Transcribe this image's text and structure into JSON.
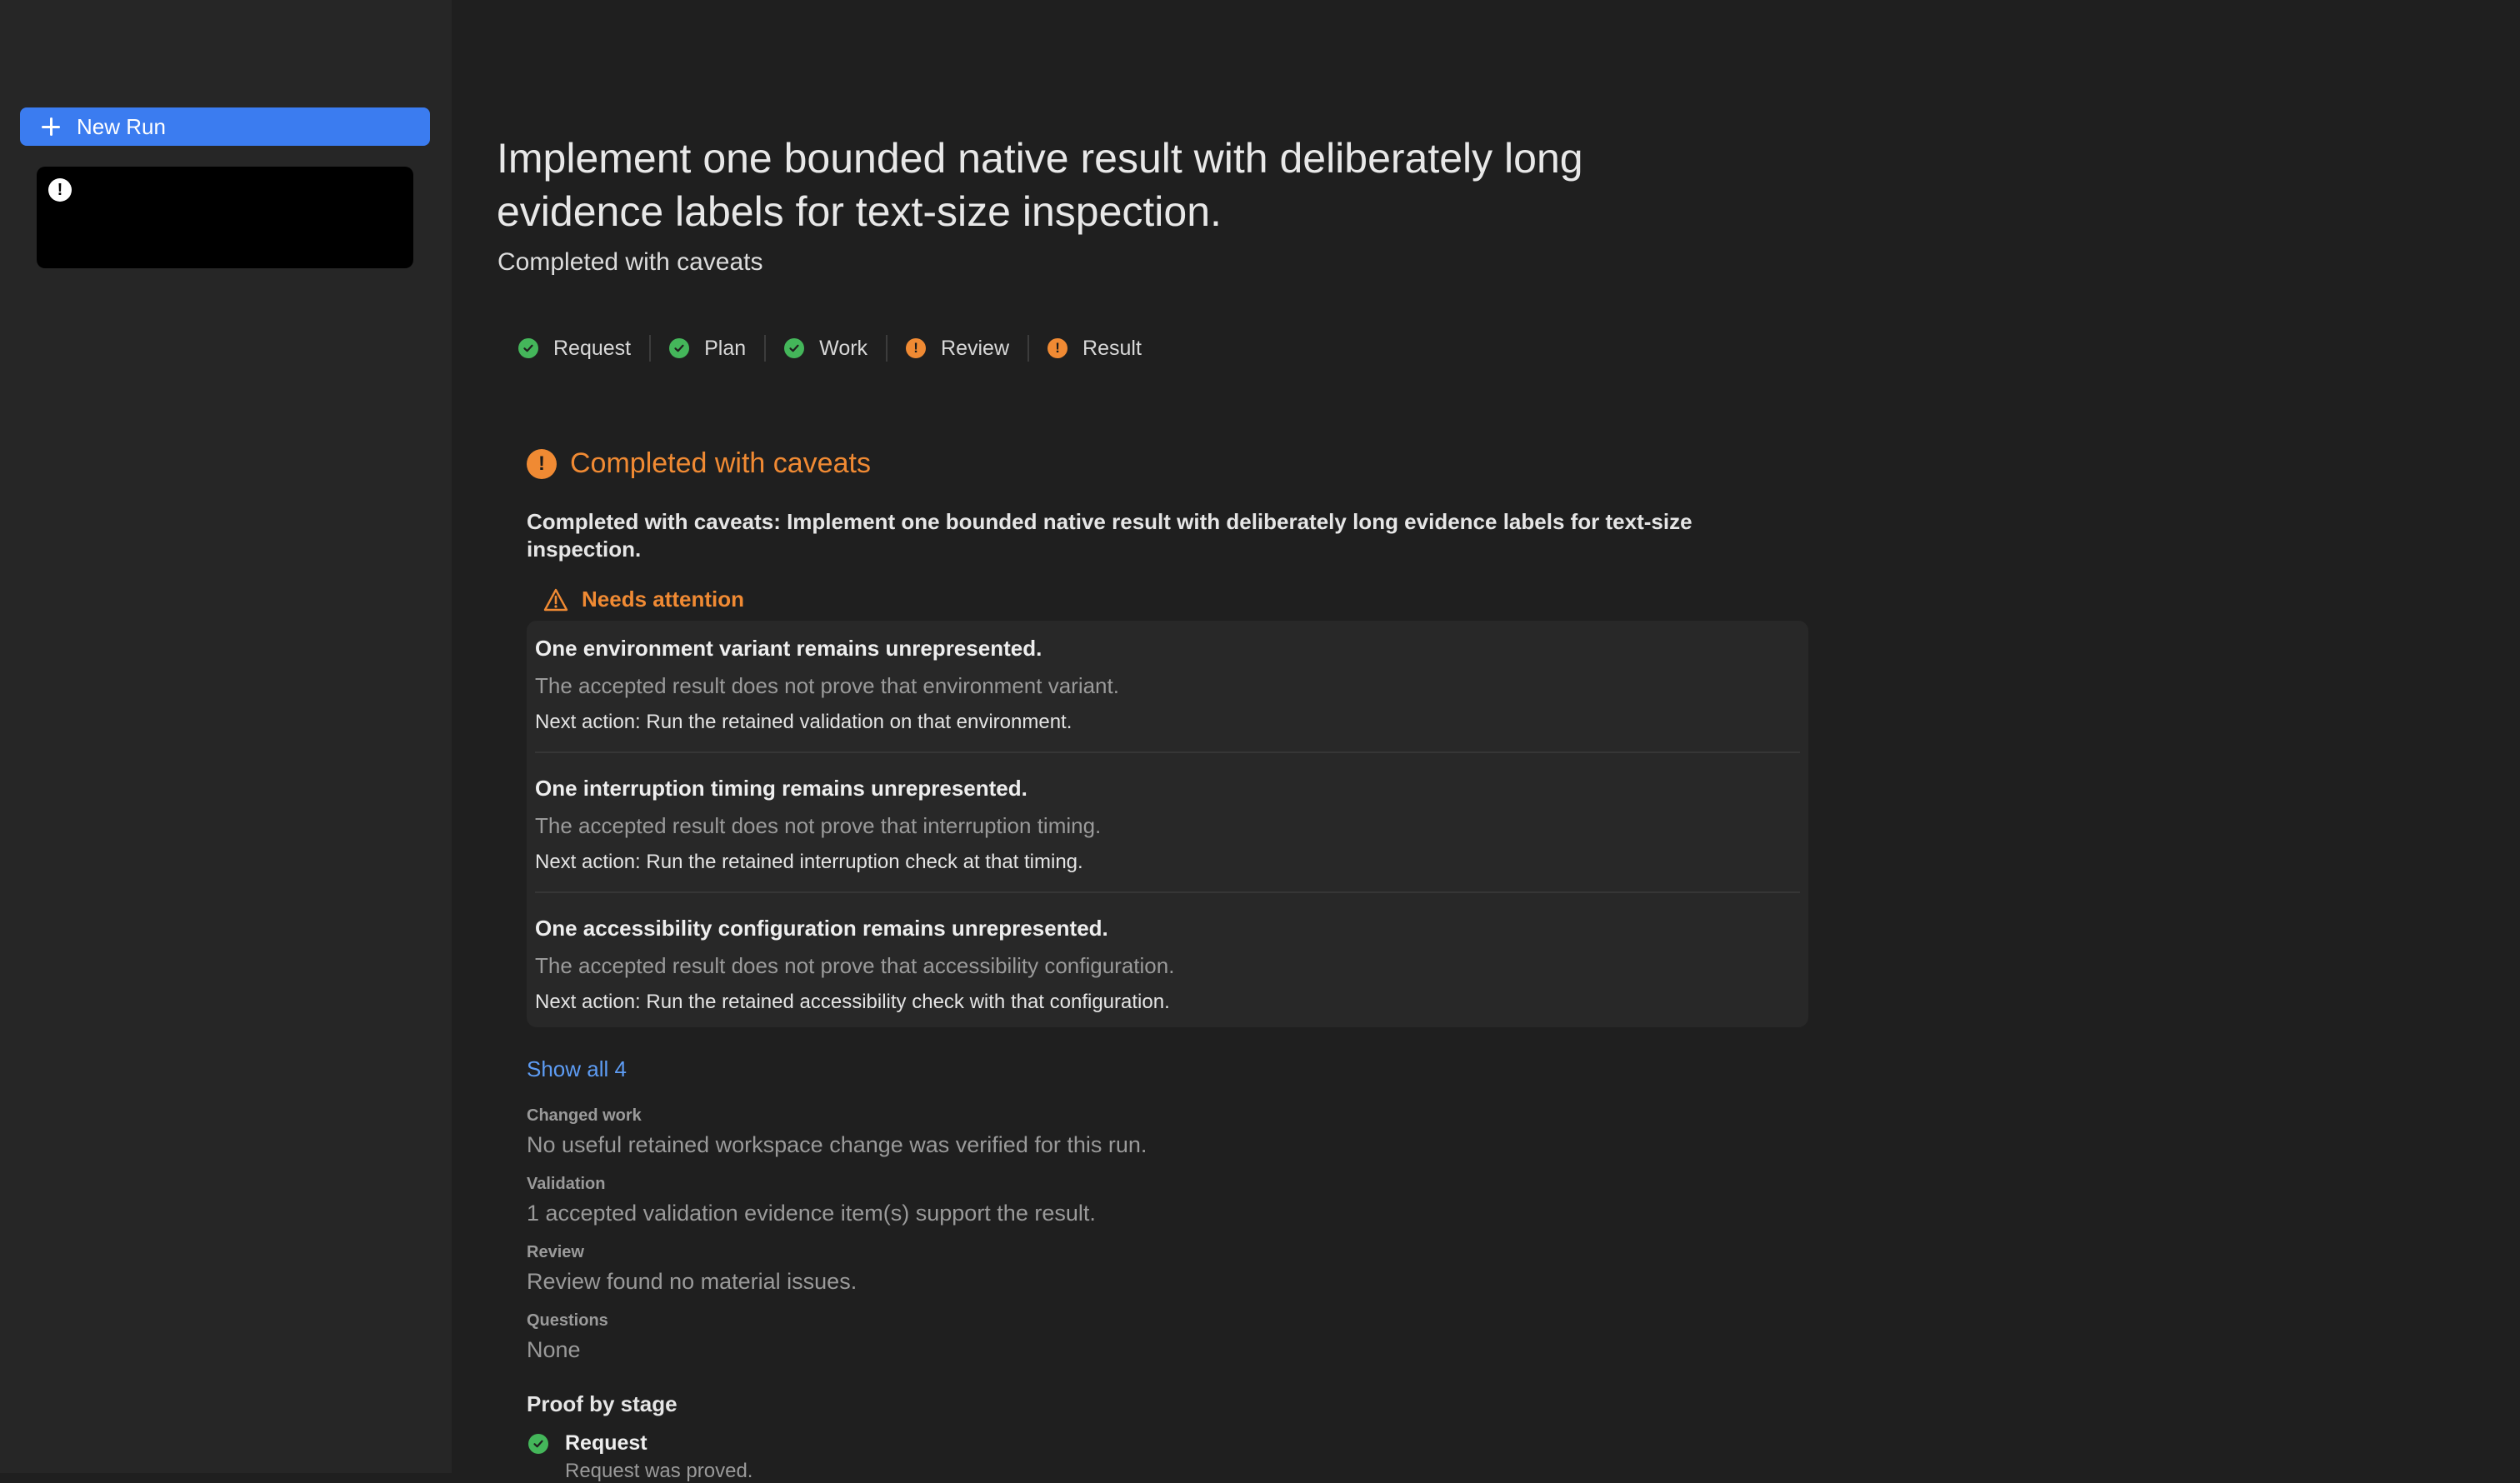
{
  "sidebar": {
    "new_run_label": "New Run",
    "run_item": {
      "status": "alert"
    }
  },
  "main": {
    "title": "Implement one bounded native result with deliberately long evidence labels for text-size inspection.",
    "subtitle": "Completed with caveats",
    "stages": [
      {
        "label": "Request",
        "status": "ok"
      },
      {
        "label": "Plan",
        "status": "ok"
      },
      {
        "label": "Work",
        "status": "ok"
      },
      {
        "label": "Review",
        "status": "warn"
      },
      {
        "label": "Result",
        "status": "warn"
      }
    ],
    "result": {
      "heading": "Completed with caveats",
      "summary": "Completed with caveats: Implement one bounded native result with deliberately long evidence labels for text-size inspection.",
      "attention_heading": "Needs attention",
      "attention_items": [
        {
          "title": "One environment variant remains unrepresented.",
          "detail": "The accepted result does not prove that environment variant.",
          "next": "Next action: Run the retained validation on that environment."
        },
        {
          "title": "One interruption timing remains unrepresented.",
          "detail": "The accepted result does not prove that interruption timing.",
          "next": "Next action: Run the retained interruption check at that timing."
        },
        {
          "title": "One accessibility configuration remains unrepresented.",
          "detail": "The accepted result does not prove that accessibility configuration.",
          "next": "Next action: Run the retained accessibility check with that configuration."
        }
      ],
      "show_all": "Show all 4",
      "fields": [
        {
          "label": "Changed work",
          "value": "No useful retained workspace change was verified for this run."
        },
        {
          "label": "Validation",
          "value": "1 accepted validation evidence item(s) support the result."
        },
        {
          "label": "Review",
          "value": "Review found no material issues."
        },
        {
          "label": "Questions",
          "value": "None"
        }
      ],
      "proof_heading": "Proof by stage",
      "proof_stages": [
        {
          "label": "Request",
          "status": "ok",
          "detail": "Request was proved."
        }
      ]
    }
  },
  "colors": {
    "accent": "#3b7cf0",
    "warning": "#f08a33",
    "success": "#44b65a",
    "link": "#5d9cf4"
  }
}
